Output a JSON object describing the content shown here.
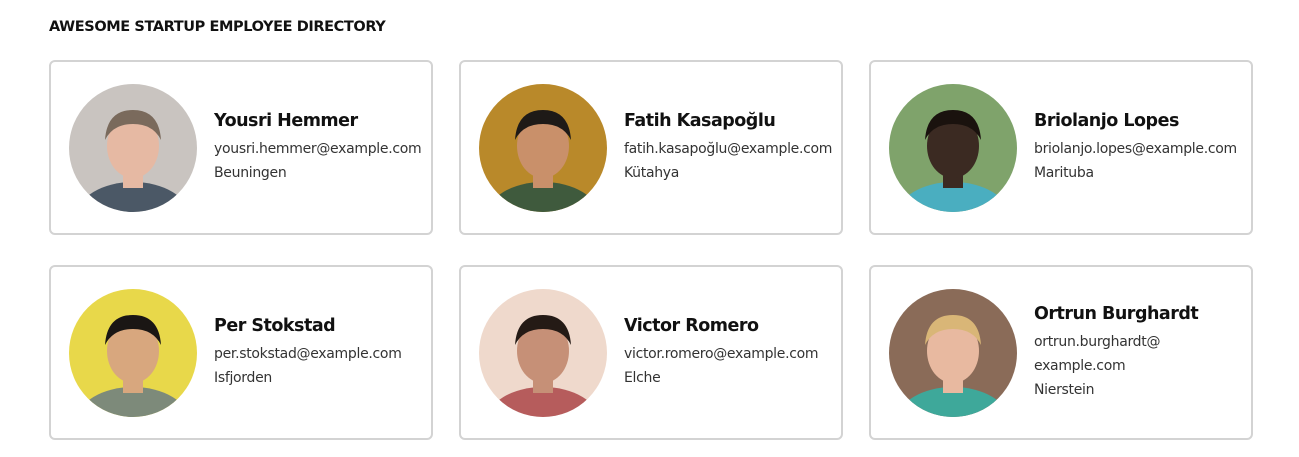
{
  "header": {
    "title": "AWESOME STARTUP EMPLOYEE DIRECTORY"
  },
  "employees": [
    {
      "name": "Yousri Hemmer",
      "email": "yousri.hemmer@example.com",
      "city": "Beuningen",
      "bg": "#c9c4c0",
      "skin": "#e6b9a3",
      "hair": "#7a6a5c",
      "shirt": "#4b5866"
    },
    {
      "name": "Fatih Kasapoğlu",
      "email": "fatih.kasapoğlu@example.com",
      "city": "Kütahya",
      "bg": "#b9892a",
      "skin": "#c9906a",
      "hair": "#1e1a17",
      "shirt": "#3f5a3d"
    },
    {
      "name": "Briolanjo Lopes",
      "email": "briolanjo.lopes@example.com",
      "city": "Marituba",
      "bg": "#7fa36b",
      "skin": "#3b2a22",
      "hair": "#1a120e",
      "shirt": "#4aaec0"
    },
    {
      "name": "Per Stokstad",
      "email": "per.stokstad@example.com",
      "city": "Isfjorden",
      "bg": "#e8d84a",
      "skin": "#d8a77e",
      "hair": "#1a1614",
      "shirt": "#7d8a7a"
    },
    {
      "name": "Victor Romero",
      "email": "victor.romero@example.com",
      "city": "Elche",
      "bg": "#efd9cc",
      "skin": "#c69077",
      "hair": "#241a15",
      "shirt": "#b65c5c"
    },
    {
      "name": "Ortrun Burghardt",
      "email": "ortrun.burghardt@\nexample.com",
      "city": "Nierstein",
      "bg": "#8a6b58",
      "skin": "#e8b9a0",
      "hair": "#d9b677",
      "shirt": "#3ea89a"
    }
  ]
}
